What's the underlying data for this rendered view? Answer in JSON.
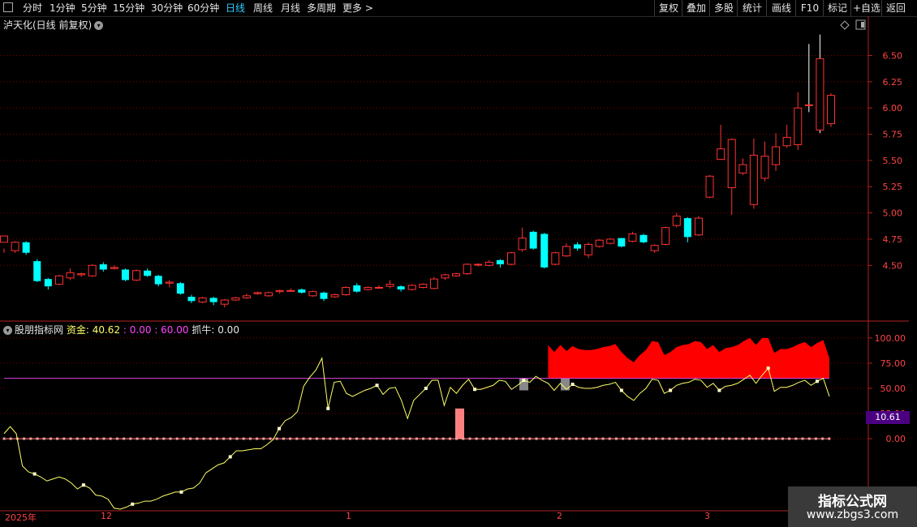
{
  "toolbar": {
    "periods": [
      "分时",
      "1分钟",
      "5分钟",
      "15分钟",
      "30分钟",
      "60分钟",
      "日线",
      "周线",
      "月线",
      "多周期",
      "更多 >"
    ],
    "active_period": "日线",
    "right_buttons": [
      "复权",
      "叠加",
      "多股",
      "统计",
      "画线",
      "F10",
      "标记",
      "+自选",
      "返回"
    ]
  },
  "main_panel": {
    "title": "泸天化(日线 前复权)"
  },
  "indicator_panel": {
    "name": "股朋指标网",
    "fund_label": "资金:",
    "fund_value": "40.62",
    "sep1": ": 0.00",
    "sep2": ": 60.00",
    "catch_label": "抓牛:",
    "catch_value": "0.00",
    "current_box": "10.61"
  },
  "watermark": {
    "title": "指标公式网",
    "url": "www.zbgs3.com"
  },
  "date_axis": [
    "2025年",
    "12",
    "1",
    "2",
    "3"
  ],
  "chart_data": [
    {
      "type": "candlestick",
      "title": "泸天化(日线 前复权)",
      "y_ticks": [
        4.5,
        4.75,
        5.0,
        5.25,
        5.5,
        5.75,
        6.0,
        6.25,
        6.5
      ],
      "ylim": [
        4.0,
        6.72
      ],
      "grid": true,
      "up_color": "#ff3232",
      "down_color": "#00ffff",
      "candles": [
        [
          4.72,
          4.78,
          4.66,
          4.62
        ],
        [
          4.64,
          4.72,
          4.73,
          4.62
        ],
        [
          4.72,
          4.62,
          4.73,
          4.6
        ],
        [
          4.54,
          4.35,
          4.56,
          4.34
        ],
        [
          4.37,
          4.3,
          4.38,
          4.27
        ],
        [
          4.32,
          4.4,
          4.41,
          4.31
        ],
        [
          4.38,
          4.43,
          4.47,
          4.36
        ],
        [
          4.41,
          4.42,
          4.43,
          4.39
        ],
        [
          4.4,
          4.5,
          4.51,
          4.39
        ],
        [
          4.51,
          4.46,
          4.53,
          4.44
        ],
        [
          4.47,
          4.48,
          4.5,
          4.46
        ],
        [
          4.46,
          4.36,
          4.47,
          4.35
        ],
        [
          4.36,
          4.45,
          4.46,
          4.35
        ],
        [
          4.45,
          4.4,
          4.47,
          4.39
        ],
        [
          4.4,
          4.32,
          4.41,
          4.3
        ],
        [
          4.33,
          4.34,
          4.36,
          4.29
        ],
        [
          4.33,
          4.23,
          4.34,
          4.22
        ],
        [
          4.2,
          4.16,
          4.22,
          4.14
        ],
        [
          4.15,
          4.19,
          4.2,
          4.14
        ],
        [
          4.19,
          4.15,
          4.2,
          4.12
        ],
        [
          4.13,
          4.17,
          4.18,
          4.1
        ],
        [
          4.17,
          4.19,
          4.2,
          4.16
        ],
        [
          4.19,
          4.21,
          4.23,
          4.18
        ],
        [
          4.23,
          4.24,
          4.25,
          4.22
        ],
        [
          4.21,
          4.24,
          4.25,
          4.2
        ],
        [
          4.25,
          4.26,
          4.27,
          4.23
        ],
        [
          4.26,
          4.26,
          4.28,
          4.25
        ],
        [
          4.27,
          4.24,
          4.28,
          4.23
        ],
        [
          4.21,
          4.25,
          4.26,
          4.2
        ],
        [
          4.24,
          4.18,
          4.25,
          4.16
        ],
        [
          4.2,
          4.22,
          4.23,
          4.19
        ],
        [
          4.22,
          4.29,
          4.3,
          4.21
        ],
        [
          4.31,
          4.25,
          4.33,
          4.24
        ],
        [
          4.27,
          4.29,
          4.3,
          4.26
        ],
        [
          4.29,
          4.29,
          4.31,
          4.28
        ],
        [
          4.3,
          4.32,
          4.36,
          4.28
        ],
        [
          4.3,
          4.27,
          4.31,
          4.25
        ],
        [
          4.27,
          4.31,
          4.32,
          4.26
        ],
        [
          4.29,
          4.32,
          4.33,
          4.28
        ],
        [
          4.28,
          4.37,
          4.39,
          4.27
        ],
        [
          4.38,
          4.41,
          4.42,
          4.36
        ],
        [
          4.4,
          4.42,
          4.43,
          4.39
        ],
        [
          4.42,
          4.51,
          4.52,
          4.41
        ],
        [
          4.51,
          4.51,
          4.52,
          4.49
        ],
        [
          4.5,
          4.53,
          4.55,
          4.49
        ],
        [
          4.55,
          4.51,
          4.56,
          4.48
        ],
        [
          4.51,
          4.62,
          4.63,
          4.5
        ],
        [
          4.65,
          4.76,
          4.86,
          4.63
        ],
        [
          4.82,
          4.66,
          4.83,
          4.65
        ],
        [
          4.8,
          4.48,
          4.81,
          4.47
        ],
        [
          4.51,
          4.62,
          4.63,
          4.5
        ],
        [
          4.59,
          4.68,
          4.71,
          4.58
        ],
        [
          4.7,
          4.66,
          4.72,
          4.64
        ],
        [
          4.6,
          4.7,
          4.72,
          4.57
        ],
        [
          4.68,
          4.74,
          4.75,
          4.67
        ],
        [
          4.71,
          4.75,
          4.76,
          4.7
        ],
        [
          4.76,
          4.68,
          4.76,
          4.67
        ],
        [
          4.73,
          4.8,
          4.82,
          4.72
        ],
        [
          4.79,
          4.72,
          4.8,
          4.71
        ],
        [
          4.64,
          4.69,
          4.7,
          4.62
        ],
        [
          4.7,
          4.86,
          4.87,
          4.69
        ],
        [
          4.88,
          4.97,
          5.0,
          4.86
        ],
        [
          4.95,
          4.77,
          4.96,
          4.72
        ],
        [
          4.79,
          4.95,
          4.97,
          4.78
        ],
        [
          5.15,
          5.35,
          5.36,
          5.14
        ],
        [
          5.51,
          5.61,
          5.84,
          5.53
        ],
        [
          5.24,
          5.7,
          5.71,
          4.98
        ],
        [
          5.38,
          5.46,
          5.52,
          5.36
        ],
        [
          5.08,
          5.55,
          5.71,
          5.04
        ],
        [
          5.33,
          5.54,
          5.68,
          5.3
        ],
        [
          5.46,
          5.63,
          5.76,
          5.4
        ],
        [
          5.64,
          5.72,
          5.84,
          5.62
        ],
        [
          5.65,
          6.0,
          6.15,
          5.6
        ],
        [
          6.03,
          6.03,
          6.61,
          5.96
        ],
        [
          5.79,
          6.47,
          6.7,
          5.76
        ],
        [
          5.85,
          6.12,
          6.14,
          5.82
        ]
      ]
    },
    {
      "type": "line",
      "title": "股朋指标网",
      "y_ticks": [
        0.0,
        25.0,
        50.0,
        75.0,
        100.0
      ],
      "ylim": [
        -70,
        112
      ],
      "grid": true,
      "series": [
        {
          "name": "资金",
          "color": "#ffff66",
          "values": [
            5,
            12,
            5,
            -27,
            -33,
            -35,
            -38,
            -42,
            -40,
            -38,
            -40,
            -44,
            -50,
            -46,
            -49,
            -56,
            -57,
            -60,
            -69,
            -70,
            -68,
            -65,
            -64,
            -62,
            -62,
            -60,
            -57,
            -55,
            -53,
            -53,
            -50,
            -49,
            -44,
            -34,
            -30,
            -26,
            -24,
            -18,
            -12,
            -12,
            -11,
            -10,
            -10,
            -6,
            -1,
            10,
            18,
            21,
            27,
            52,
            61,
            68,
            80,
            30,
            56,
            57,
            45,
            42,
            45,
            48,
            50,
            53,
            44,
            50,
            51,
            38,
            20,
            38,
            44,
            50,
            58,
            58,
            33,
            51,
            45,
            53,
            59,
            49,
            49,
            51,
            53,
            58,
            57,
            49,
            53,
            58,
            56,
            62,
            58,
            55,
            48,
            55,
            49,
            54,
            51,
            50,
            50,
            51,
            53,
            54,
            56,
            48,
            42,
            38,
            45,
            50,
            59,
            58,
            45,
            48,
            53,
            55,
            56,
            59,
            58,
            51,
            55,
            48,
            52,
            53,
            55,
            59,
            63,
            55,
            63,
            70,
            47,
            51,
            51,
            53,
            56,
            58,
            53,
            57,
            60,
            42
          ]
        },
        {
          "name": "抓牛",
          "color": "#ff8888",
          "values": [
            0
          ]
        }
      ],
      "reference_lines": [
        {
          "value": 60,
          "color": "#dd44dd"
        },
        {
          "value": 0,
          "color": "#ff8888"
        }
      ]
    }
  ]
}
